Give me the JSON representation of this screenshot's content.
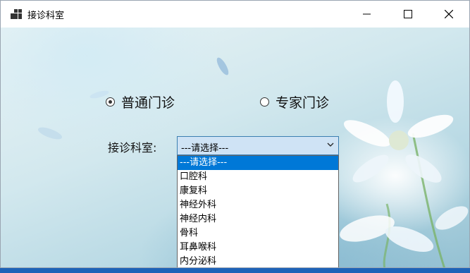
{
  "window": {
    "title": "接诊科室",
    "app_icon": "app-window-icon",
    "controls": [
      "minimize-icon",
      "maximize-icon",
      "close-icon"
    ]
  },
  "form": {
    "radio_general": {
      "label": "普通门诊",
      "checked": true
    },
    "radio_expert": {
      "label": "专家门诊",
      "checked": false
    },
    "department_label": "接诊科室:",
    "department_select": {
      "value": "---请选择---",
      "options": [
        "---请选择---",
        "口腔科",
        "康复科",
        "神经外科",
        "神经内科",
        "骨科",
        "耳鼻喉科",
        "内分泌科"
      ],
      "highlighted_index": 0
    }
  },
  "colors": {
    "selection": "#0078d7",
    "combo_background": "#cfe3f5",
    "combo_border": "#3c7fb1"
  }
}
